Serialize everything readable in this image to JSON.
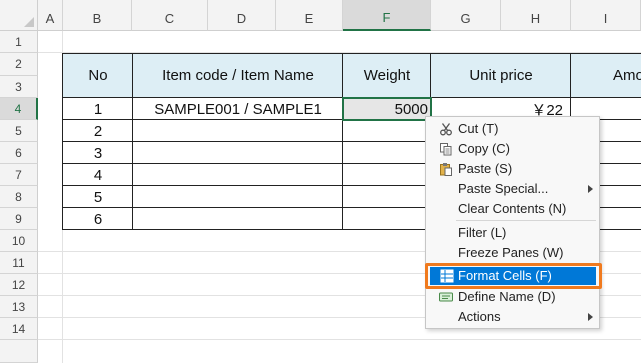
{
  "columns": [
    "A",
    "B",
    "C",
    "D",
    "E",
    "F",
    "G",
    "H",
    "I"
  ],
  "rows": [
    "1",
    "2",
    "3",
    "4",
    "5",
    "6",
    "7",
    "8",
    "9",
    "10",
    "11",
    "12",
    "13",
    "14"
  ],
  "table": {
    "headers": [
      "No",
      "Item code / Item Name",
      "Weight",
      "Unit price",
      "Amo"
    ],
    "row1": {
      "no": "1",
      "item": "SAMPLE001 / SAMPLE1",
      "weight": "5000",
      "price": "￥22"
    },
    "numbers": [
      "2",
      "3",
      "4",
      "5",
      "6"
    ]
  },
  "context_menu": {
    "cut": "Cut (T)",
    "copy": "Copy (C)",
    "paste": "Paste (S)",
    "paste_special": "Paste Special...",
    "clear_contents": "Clear Contents (N)",
    "filter": "Filter (L)",
    "freeze_panes": "Freeze Panes (W)",
    "format_cells": "Format Cells (F)",
    "define_name": "Define Name (D)",
    "actions": "Actions"
  },
  "colors": {
    "header_fill": "#ddeef5",
    "selection_green": "#217346",
    "menu_highlight": "#0078d7",
    "callout_orange": "#f07a1e"
  }
}
